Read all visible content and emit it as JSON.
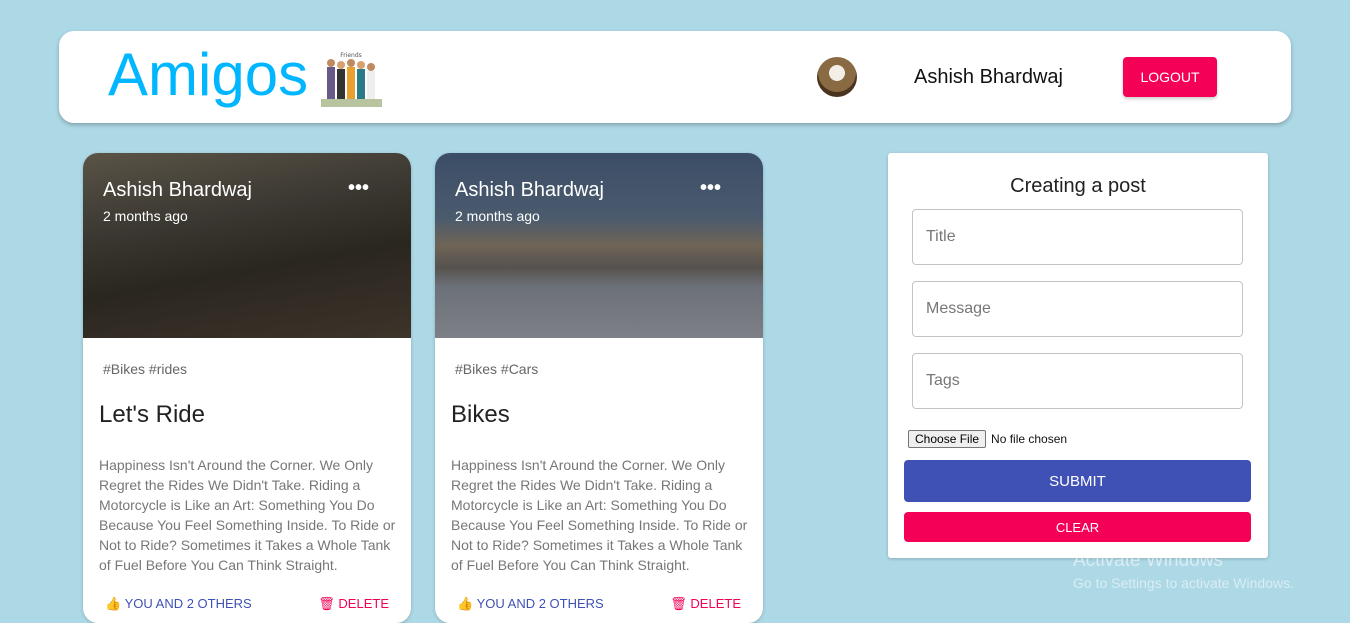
{
  "header": {
    "brand": "Amigos",
    "logo_text": "Friends",
    "user_name": "Ashish Bhardwaj",
    "logout_label": "LOGOUT"
  },
  "posts": [
    {
      "author": "Ashish Bhardwaj",
      "time": "2 months ago",
      "tags": "#Bikes #rides",
      "title": "Let's Ride",
      "message": "Happiness Isn't Around the Corner. We Only Regret the Rides We Didn't Take. Riding a Motorcycle is Like an Art: Something You Do Because You Feel Something Inside. To Ride or Not to Ride? Sometimes it Takes a Whole Tank of Fuel Before You Can Think Straight.",
      "likes": "YOU AND 2 OTHERS",
      "delete": "DELETE"
    },
    {
      "author": "Ashish Bhardwaj",
      "time": "2 months ago",
      "tags": "#Bikes #Cars",
      "title": "Bikes",
      "message": "Happiness Isn't Around the Corner. We Only Regret the Rides We Didn't Take. Riding a Motorcycle is Like an Art: Something You Do Because You Feel Something Inside. To Ride or Not to Ride? Sometimes it Takes a Whole Tank of Fuel Before You Can Think Straight.",
      "likes": "YOU AND 2 OTHERS",
      "delete": "DELETE"
    }
  ],
  "form": {
    "title": "Creating a post",
    "title_placeholder": "Title",
    "message_placeholder": "Message",
    "tags_placeholder": "Tags",
    "choose_file": "Choose File",
    "no_file": "No file chosen",
    "submit": "SUBMIT",
    "clear": "CLEAR"
  },
  "watermark": {
    "line1": "Activate Windows",
    "line2": "Go to Settings to activate Windows."
  }
}
